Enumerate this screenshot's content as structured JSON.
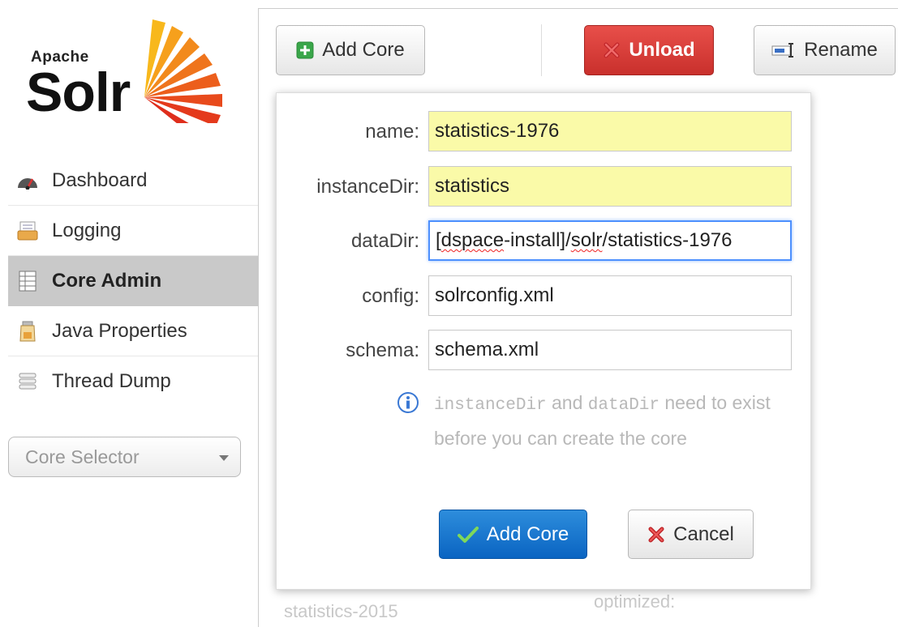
{
  "logo": {
    "apache": "Apache",
    "solr": "Solr"
  },
  "sidebar": {
    "items": [
      {
        "label": "Dashboard",
        "icon": "dashboard-icon"
      },
      {
        "label": "Logging",
        "icon": "logging-icon"
      },
      {
        "label": "Core Admin",
        "icon": "core-admin-icon",
        "active": true
      },
      {
        "label": "Java Properties",
        "icon": "java-properties-icon"
      },
      {
        "label": "Thread Dump",
        "icon": "thread-dump-icon"
      }
    ],
    "core_selector": {
      "placeholder": "Core Selector"
    }
  },
  "toolbar": {
    "add_core": "Add Core",
    "unload": "Unload",
    "rename": "Rename"
  },
  "background": {
    "core_name": "statistics-2015",
    "optimized": "optimized:"
  },
  "dialog": {
    "fields": {
      "name": {
        "label": "name:",
        "value": "statistics-1976"
      },
      "instanceDir": {
        "label": "instanceDir:",
        "value": "statistics"
      },
      "dataDir": {
        "label": "dataDir:",
        "value_prefix": "[",
        "value_part1": "dspace",
        "value_part2": "-install]/",
        "value_part3": "solr",
        "value_part4": "/statistics-1976"
      },
      "config": {
        "label": "config:",
        "value": "solrconfig.xml"
      },
      "schema": {
        "label": "schema:",
        "value": "schema.xml"
      }
    },
    "info": {
      "code1": "instanceDir",
      "text1": " and ",
      "code2": "dataDir",
      "text2": " need to exist before you can create the core"
    },
    "submit": "Add Core",
    "cancel": "Cancel"
  },
  "colors": {
    "active_nav": "#c9c9c9",
    "unload_red": "#d9423e",
    "submit_blue": "#1a78d0",
    "required_field": "#fafaa8"
  }
}
